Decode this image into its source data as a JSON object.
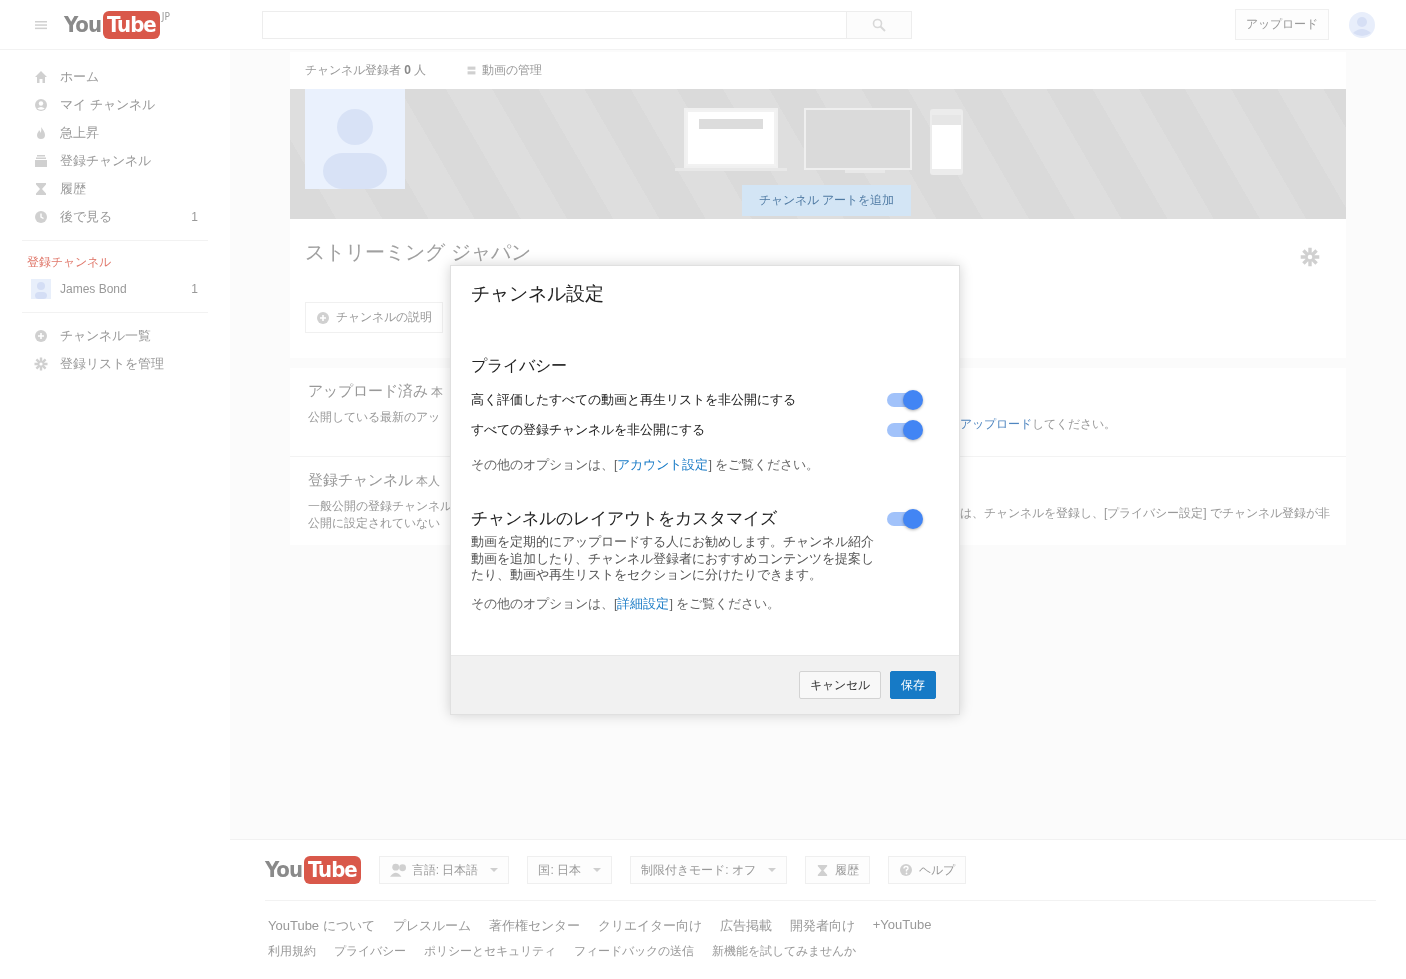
{
  "header": {
    "logo": {
      "you": "You",
      "tube": "Tube",
      "region": "JP"
    },
    "upload_button": "アップロード"
  },
  "sidebar": {
    "items": [
      {
        "label": "ホーム"
      },
      {
        "label": "マイ チャンネル"
      },
      {
        "label": "急上昇"
      },
      {
        "label": "登録チャンネル"
      },
      {
        "label": "履歴"
      },
      {
        "label": "後で見る",
        "count": "1"
      }
    ],
    "section_title": "登録チャンネル",
    "subscriptions": [
      {
        "name": "James Bond",
        "count": "1"
      }
    ],
    "bottom_items": [
      {
        "label": "チャンネル一覧"
      },
      {
        "label": "登録リストを管理"
      }
    ]
  },
  "channel": {
    "subscribers": "チャンネル登録者 **0** 人",
    "manage_videos": "動画の管理",
    "add_art_button": "チャンネル アートを追加",
    "name": "ストリーミング ジャパン",
    "description_button": "チャンネルの説明",
    "sections": [
      {
        "title": "アップロード済み",
        "note": "本",
        "text_left": [
          "公開している最新のアッ"
        ],
        "text_right": {
          "link": "アップロード",
          "after": "してください。"
        }
      },
      {
        "title": "登録チャンネル",
        "note": "本人",
        "text_left": [
          "一般公開の登録チャンネル",
          "公開に設定されていない"
        ],
        "text_right": {
          "before": "は、チャンネルを登録し、[プライバシー設定] でチャンネル登録が非"
        }
      }
    ]
  },
  "dialog": {
    "title": "チャンネル設定",
    "privacy": {
      "title": "プライバシー",
      "toggles": [
        {
          "label": "高く評価したすべての動画と再生リストを非公開にする",
          "on": true
        },
        {
          "label": "すべての登録チャンネルを非公開にする",
          "on": true
        }
      ],
      "note": {
        "before": "その他のオプションは、[",
        "link": "アカウント設定",
        "after": "] をご覧ください。"
      }
    },
    "layout": {
      "title": "チャンネルのレイアウトをカスタマイズ",
      "on": true,
      "description": "動画を定期的にアップロードする人にお勧めします。チャンネル紹介動画を追加したり、チャンネル登録者におすすめコンテンツを提案したり、動画や再生リストをセクションに分けたりできます。",
      "note": {
        "before": "その他のオプションは、[",
        "link": "詳細設定",
        "after": "] をご覧ください。"
      }
    },
    "buttons": [
      {
        "label": "キャンセル",
        "primary": false
      },
      {
        "label": "保存",
        "primary": true
      }
    ]
  },
  "footer": {
    "logo": {
      "you": "You",
      "tube": "Tube"
    },
    "buttons": [
      {
        "label": "言語: 日本語",
        "dropdown": true
      },
      {
        "label": "国: 日本",
        "dropdown": true
      },
      {
        "label": "制限付きモード: オフ",
        "dropdown": true
      },
      {
        "label": "履歴",
        "dropdown": false
      },
      {
        "label": "ヘルプ",
        "dropdown": false
      }
    ],
    "links": [
      "YouTube について",
      "プレスルーム",
      "著作権センター",
      "クリエイター向け",
      "広告掲載",
      "開発者向け",
      "+YouTube"
    ],
    "small_links": [
      "利用規約",
      "プライバシー",
      "ポリシーとセキュリティ",
      "フィードバックの送信",
      "新機能を試してみませんか"
    ]
  }
}
